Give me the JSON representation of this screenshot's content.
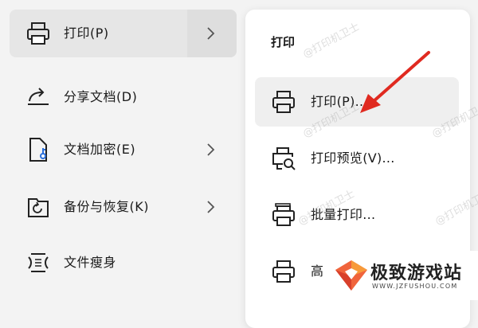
{
  "left_menu": {
    "items": [
      {
        "label": "打印(P)",
        "icon": "printer-icon",
        "has_arrow": true
      },
      {
        "label": "分享文档(D)",
        "icon": "share-icon",
        "has_arrow": false
      },
      {
        "label": "文档加密(E)",
        "icon": "document-lock-icon",
        "has_arrow": true
      },
      {
        "label": "备份与恢复(K)",
        "icon": "backup-restore-icon",
        "has_arrow": true
      },
      {
        "label": "文件瘦身",
        "icon": "file-compress-icon",
        "has_arrow": false
      }
    ]
  },
  "submenu": {
    "title": "打印",
    "items": [
      {
        "label": "打印(P)...",
        "icon": "printer-icon"
      },
      {
        "label": "打印预览(V)...",
        "icon": "print-preview-icon"
      },
      {
        "label": "批量打印...",
        "icon": "batch-print-icon"
      },
      {
        "label": "高",
        "icon": "printer-icon"
      }
    ]
  },
  "watermark": "@打印机卫士",
  "brand": {
    "name": "极致游戏站",
    "url": "WWW.JZFUSHOU.COM",
    "accent": "#f0643c"
  },
  "colors": {
    "arrow": "#e02a20",
    "highlight": "#efefef",
    "active_item": "#e6e6e6"
  }
}
